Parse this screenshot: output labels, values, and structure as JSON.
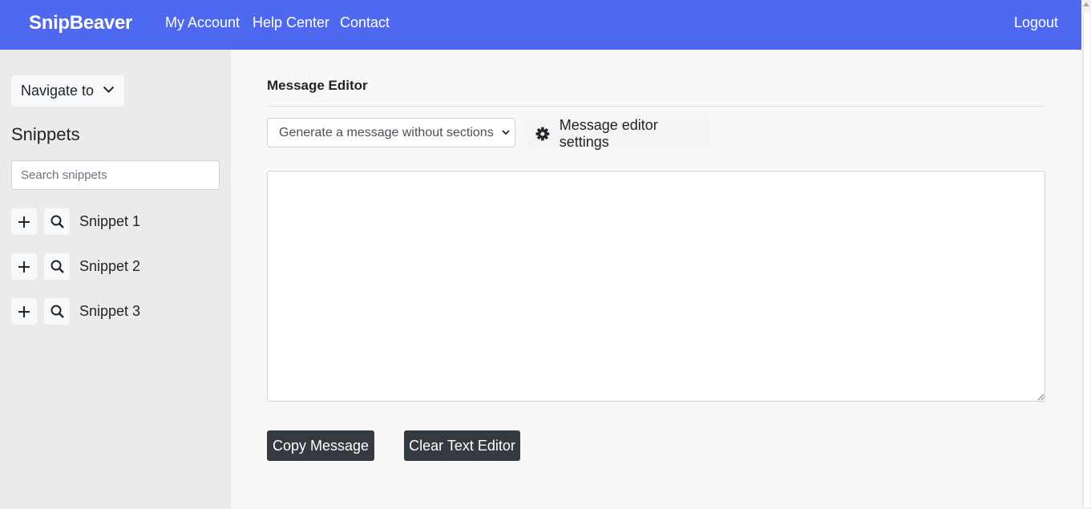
{
  "navbar": {
    "brand": "SnipBeaver",
    "links": [
      "My Account",
      "Help Center",
      "Contact"
    ],
    "logout": "Logout",
    "color": "#4f68f0"
  },
  "sidebar": {
    "navigate_label": "Navigate to",
    "navigate_icon": "chevron-down-icon",
    "title": "Snippets",
    "search_placeholder": "Search snippets",
    "search_value": "",
    "snippets": [
      {
        "label": "Snippet 1",
        "add_icon": "plus-icon",
        "view_icon": "search-icon"
      },
      {
        "label": "Snippet 2",
        "add_icon": "plus-icon",
        "view_icon": "search-icon"
      },
      {
        "label": "Snippet 3",
        "add_icon": "plus-icon",
        "view_icon": "search-icon"
      }
    ]
  },
  "main": {
    "title": "Message Editor",
    "mode_select": {
      "selected": "Generate a message without sections"
    },
    "settings_label": "Message editor settings",
    "settings_icon": "gear-icon",
    "editor_value": "",
    "buttons": {
      "copy": "Copy Message",
      "clear": "Clear Text Editor"
    },
    "button_color": "#343a40"
  }
}
